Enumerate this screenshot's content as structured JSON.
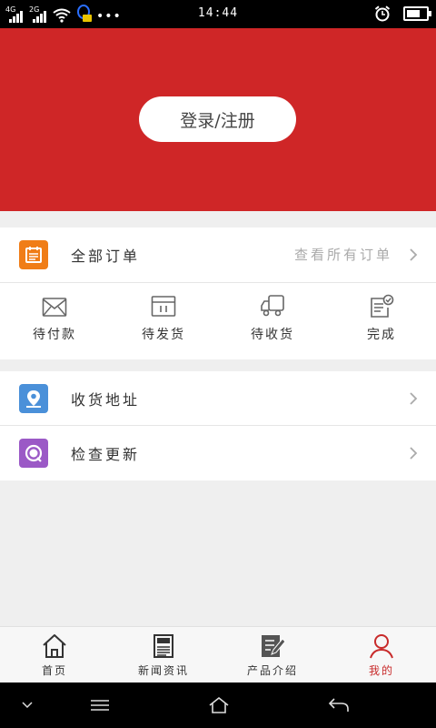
{
  "status_bar": {
    "net1": "4G",
    "net2": "2G",
    "time": "14:44",
    "dots": "•••"
  },
  "header": {
    "login_label": "登录/注册"
  },
  "orders": {
    "title": "全部订单",
    "hint": "查看所有订单",
    "statuses": [
      {
        "label": "待付款",
        "icon": "envelope-icon"
      },
      {
        "label": "待发货",
        "icon": "box-icon"
      },
      {
        "label": "待收货",
        "icon": "truck-icon"
      },
      {
        "label": "完成",
        "icon": "check-document-icon"
      }
    ]
  },
  "menu": {
    "address": {
      "title": "收货地址",
      "icon": "location-icon",
      "color": "#4a90d9"
    },
    "update": {
      "title": "检查更新",
      "icon": "refresh-icon",
      "color": "#9b59c6"
    }
  },
  "bottom_nav": [
    {
      "label": "首页",
      "icon": "home-icon"
    },
    {
      "label": "新闻资讯",
      "icon": "newspaper-icon"
    },
    {
      "label": "产品介绍",
      "icon": "edit-document-icon"
    },
    {
      "label": "我的",
      "icon": "user-icon"
    }
  ],
  "colors": {
    "brand_red": "#cf2627",
    "order_icon": "#f07d17",
    "active_nav": "#c82a2a"
  }
}
